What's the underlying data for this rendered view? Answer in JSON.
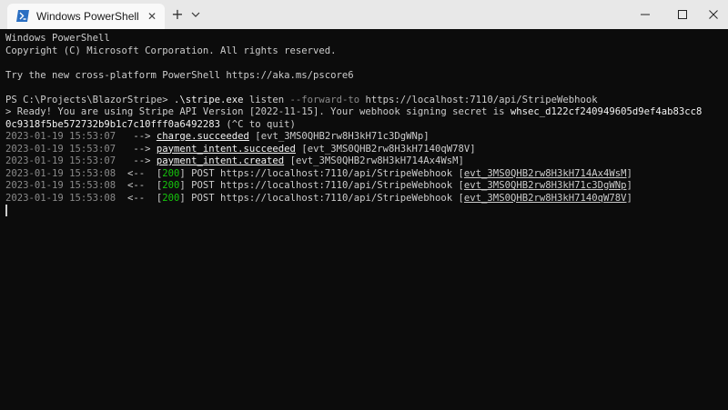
{
  "window": {
    "tab_title": "Windows PowerShell",
    "tab_icon": "powershell-icon",
    "new_tab_label": "+",
    "close_tab_label": "✕"
  },
  "terminal": {
    "banner_1": "Windows PowerShell",
    "banner_2": "Copyright (C) Microsoft Corporation. All rights reserved.",
    "banner_3": "Try the new cross-platform PowerShell https://aka.ms/pscore6",
    "prompt": "PS C:\\Projects\\BlazorStripe> ",
    "cmd_exe": ".\\stripe.exe",
    "cmd_sub": " listen ",
    "cmd_flag": "--forward-to",
    "cmd_url": " https://localhost:7110/api/StripeWebhook",
    "ready_1": "> Ready! You are using Stripe API Version [2022-11-15]. Your webhook signing secret is ",
    "secret_1": "whsec_d122cf240949605d9ef4ab83cc8",
    "secret_2": "0c9318f5be572732b9b1c7c10fff0a6492283",
    "ready_2": " (^C to quit)",
    "events": [
      {
        "ts": "2023-01-19 15:53:07",
        "arrow": "   -->",
        "name": "charge.succeeded",
        "id": "evt_3MS0QHB2rw8H3kH71c3DgWNp"
      },
      {
        "ts": "2023-01-19 15:53:07",
        "arrow": "   -->",
        "name": "payment_intent.succeeded",
        "id": "evt_3MS0QHB2rw8H3kH7140qW78V"
      },
      {
        "ts": "2023-01-19 15:53:07",
        "arrow": "   -->",
        "name": "payment_intent.created",
        "id": "evt_3MS0QHB2rw8H3kH714Ax4WsM"
      }
    ],
    "responses": [
      {
        "ts": "2023-01-19 15:53:08",
        "arrow": "  <--",
        "status": "200",
        "method": "POST",
        "url": "https://localhost:7110/api/StripeWebhook",
        "id": "evt_3MS0QHB2rw8H3kH714Ax4WsM"
      },
      {
        "ts": "2023-01-19 15:53:08",
        "arrow": "  <--",
        "status": "200",
        "method": "POST",
        "url": "https://localhost:7110/api/StripeWebhook",
        "id": "evt_3MS0QHB2rw8H3kH71c3DgWNp"
      },
      {
        "ts": "2023-01-19 15:53:08",
        "arrow": "  <--",
        "status": "200",
        "method": "POST",
        "url": "https://localhost:7110/api/StripeWebhook",
        "id": "evt_3MS0QHB2rw8H3kH7140qW78V"
      }
    ]
  },
  "colors": {
    "background": "#0c0c0c",
    "text": "#cccccc",
    "timestamp": "#8a8a8a",
    "status_ok": "#16c60c",
    "titlebar": "#e8e8e8"
  }
}
